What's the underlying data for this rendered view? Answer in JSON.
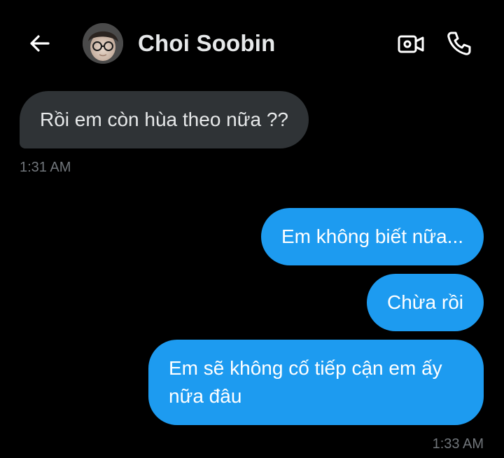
{
  "header": {
    "contact_name": "Choi Soobin",
    "back_icon": "arrow-left-icon",
    "video_icon": "video-camera-icon",
    "call_icon": "phone-icon"
  },
  "messages": [
    {
      "direction": "received",
      "text": "Rồi em còn hùa theo nữa ??"
    },
    {
      "direction": "sent",
      "text": "Em không biết nữa..."
    },
    {
      "direction": "sent",
      "text": "Chừa rồi"
    },
    {
      "direction": "sent",
      "text": "Em sẽ không cố tiếp cận em ấy nữa đâu"
    }
  ],
  "timestamps": {
    "received": "1:31 AM",
    "sent": "1:33 AM"
  },
  "colors": {
    "background": "#000000",
    "sent_bubble": "#1d9bf0",
    "received_bubble": "#2f3336",
    "timestamp": "#71767b"
  }
}
